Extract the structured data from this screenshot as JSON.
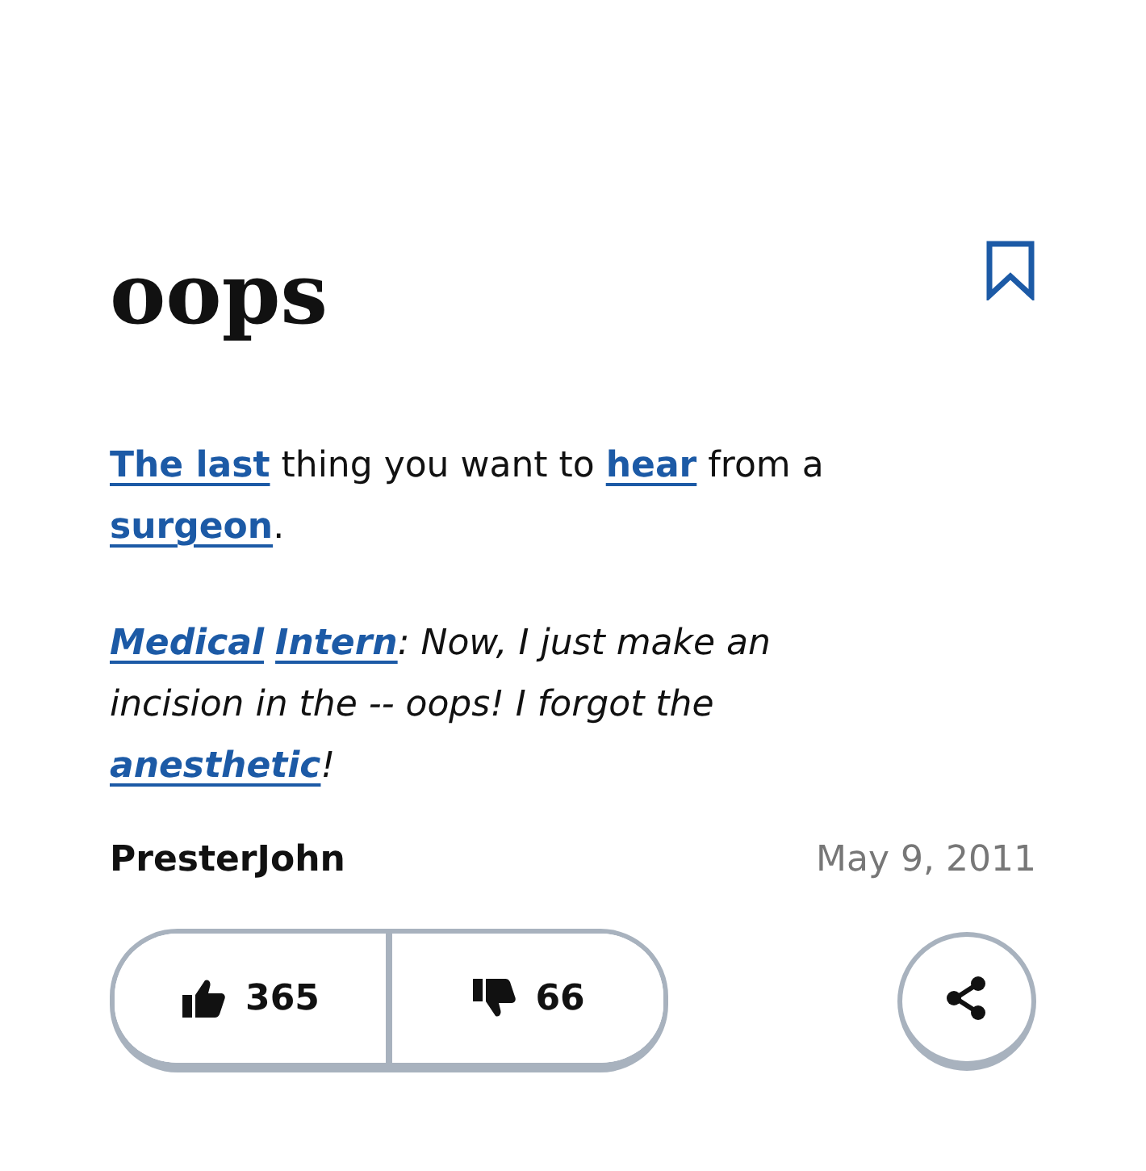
{
  "word": "oops",
  "bookmarked": false,
  "definition": [
    {
      "kind": "link",
      "text": "The last"
    },
    {
      "kind": "text",
      "text": " thing you want to "
    },
    {
      "kind": "link",
      "text": "hear"
    },
    {
      "kind": "text",
      "text": " from a "
    },
    {
      "kind": "link",
      "text": "surgeon"
    },
    {
      "kind": "text",
      "text": "."
    }
  ],
  "example": [
    {
      "kind": "link",
      "text": "Medical",
      "space_after": true
    },
    {
      "kind": "link",
      "text": "Intern"
    },
    {
      "kind": "text",
      "text": ": Now, I just make an incision in the -- oops! I forgot the "
    },
    {
      "kind": "link",
      "text": "anesthetic"
    },
    {
      "kind": "text",
      "text": "!"
    }
  ],
  "author": "PresterJohn",
  "date": "May 9, 2011",
  "upvotes": "365",
  "downvotes": "66"
}
